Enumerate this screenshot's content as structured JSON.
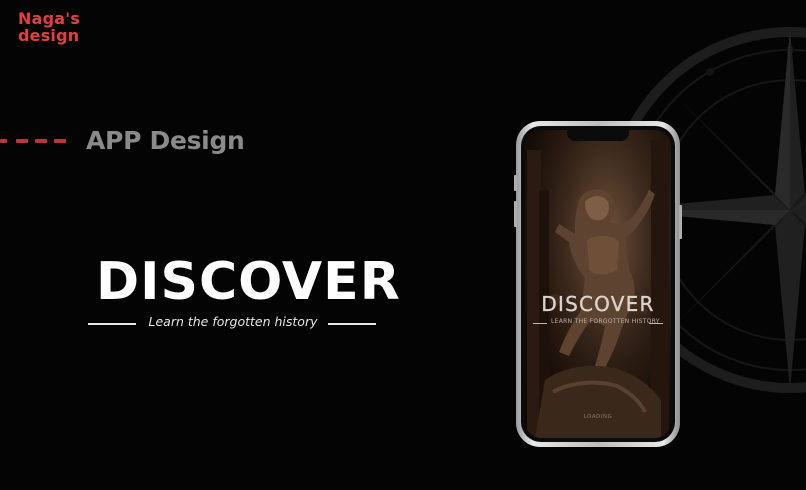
{
  "brand": {
    "line1": "Naga's",
    "line2": "design",
    "color": "#e0413f"
  },
  "section": {
    "title": "APP Design",
    "accent_color": "#b8373a"
  },
  "hero": {
    "title": "DISCOVER",
    "subtitle": "Learn the forgotten history"
  },
  "phone_screen": {
    "title": "DISCOVER",
    "subtitle": "LEARN THE FORGOTTEN HISTORY",
    "status": "LOADING"
  },
  "icons": {
    "compass": "compass-rose-icon"
  }
}
